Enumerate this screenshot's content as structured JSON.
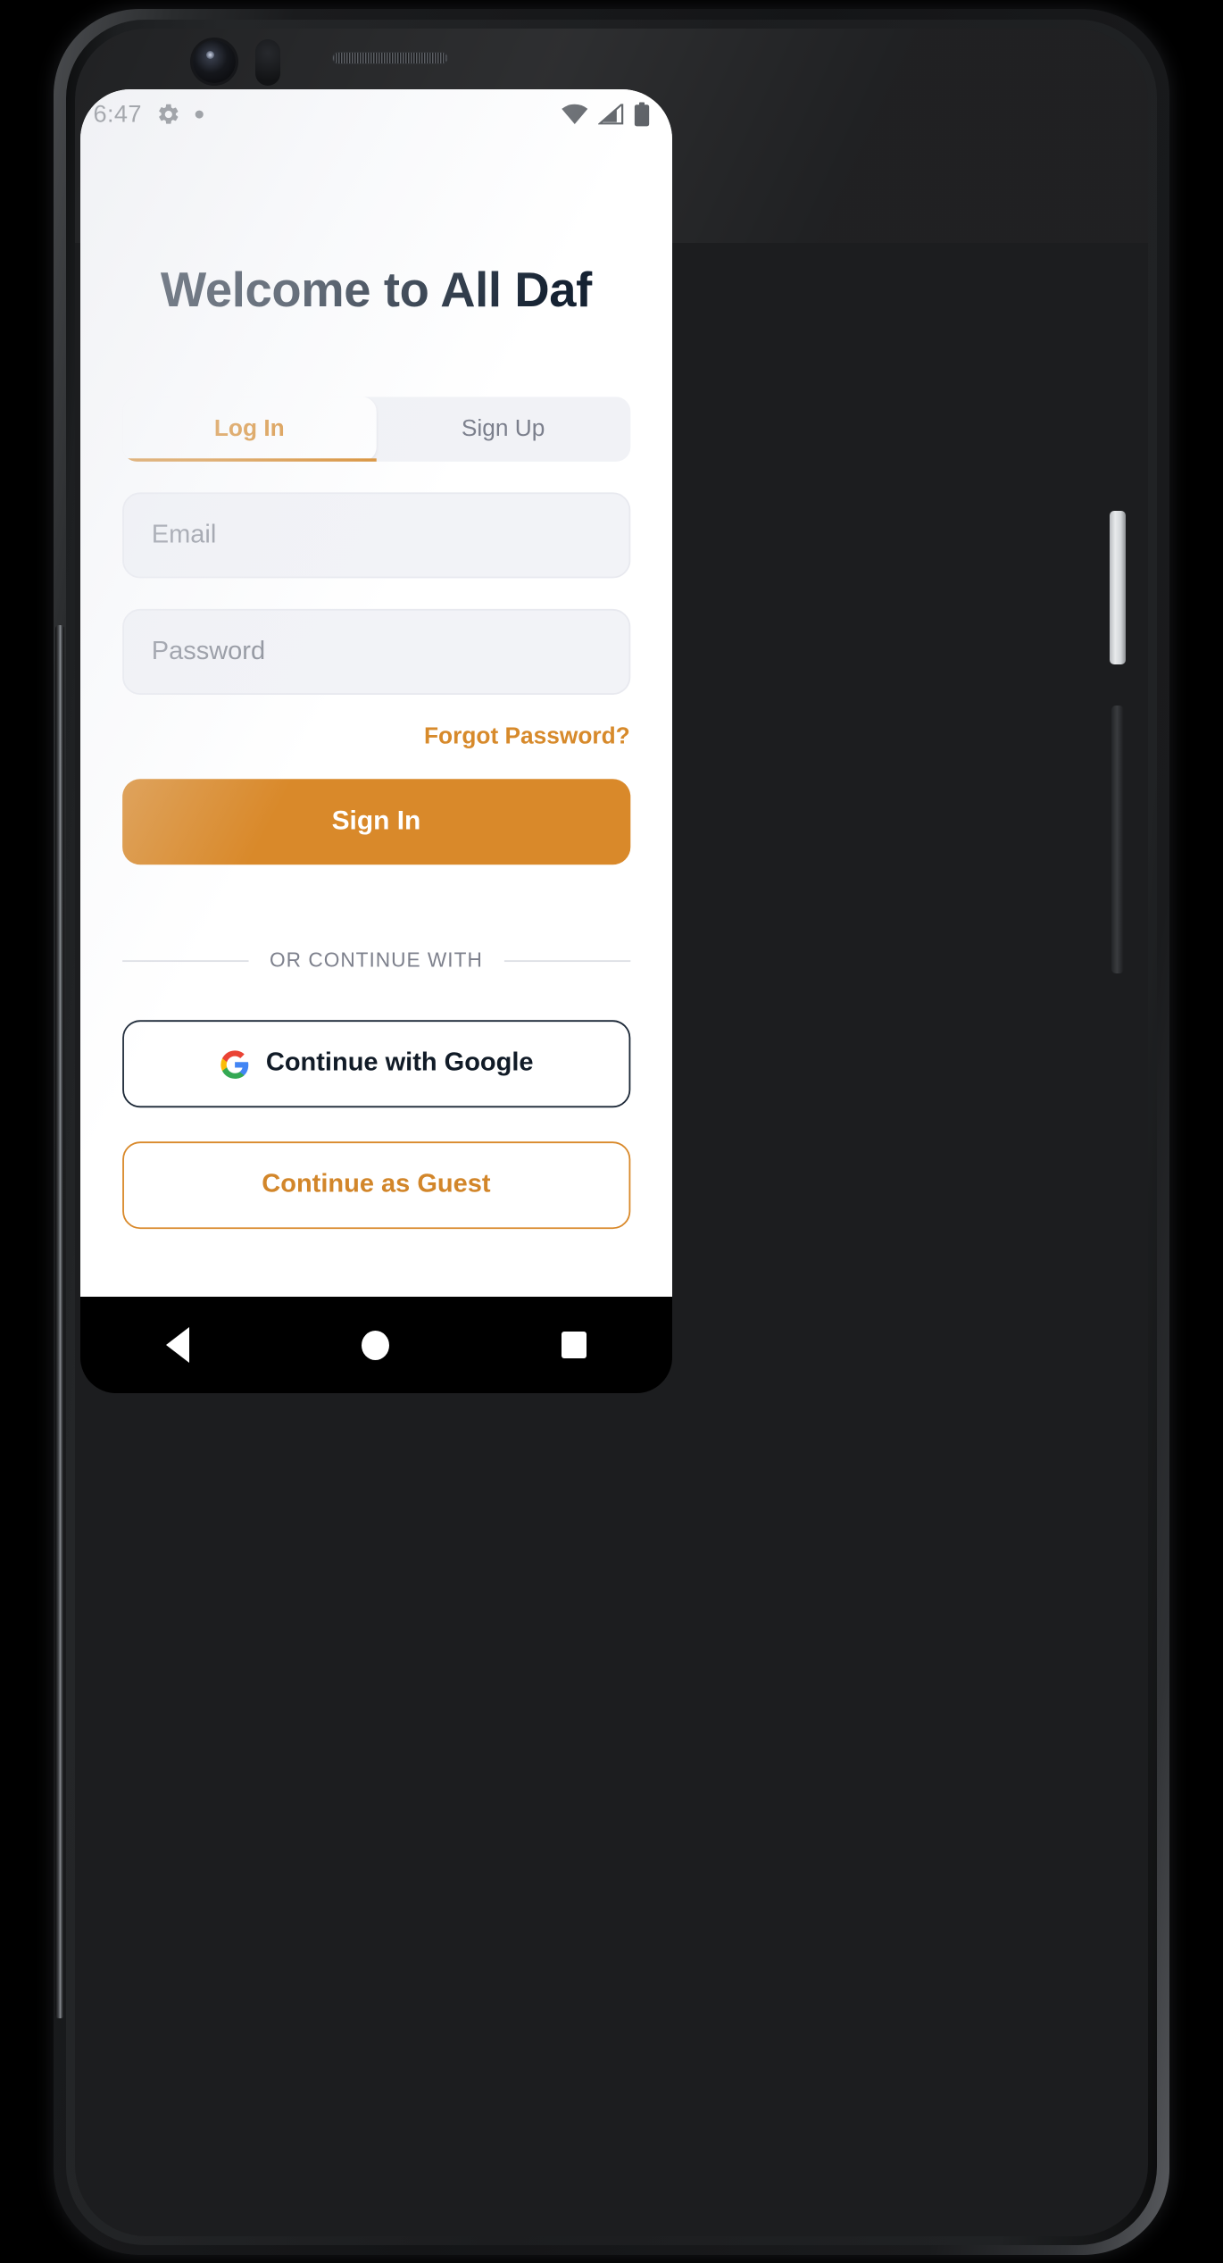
{
  "device": {
    "frame": "android-phone-mockup",
    "accent_color": "#d9892a",
    "title_color": "#152232"
  },
  "status_bar": {
    "time": "6:47",
    "icons_left": [
      "gear-icon",
      "dot-icon"
    ],
    "icons_right": [
      "wifi-icon",
      "cellular-signal-icon",
      "battery-icon"
    ]
  },
  "screen": {
    "title": "Welcome to All Daf",
    "tabs": [
      {
        "label": "Log In",
        "active": true
      },
      {
        "label": "Sign Up",
        "active": false
      }
    ],
    "fields": [
      {
        "name": "email",
        "placeholder": "Email",
        "value": ""
      },
      {
        "name": "password",
        "placeholder": "Password",
        "value": ""
      }
    ],
    "forgot_password_label": "Forgot Password?",
    "primary_button_label": "Sign In",
    "divider_label": "OR CONTINUE WITH",
    "google_button_label": "Continue with Google",
    "guest_button_label": "Continue as Guest"
  },
  "nav_bar": {
    "items": [
      {
        "name": "back",
        "icon": "triangle-back-icon"
      },
      {
        "name": "home",
        "icon": "circle-home-icon"
      },
      {
        "name": "recents",
        "icon": "square-recents-icon"
      }
    ]
  }
}
